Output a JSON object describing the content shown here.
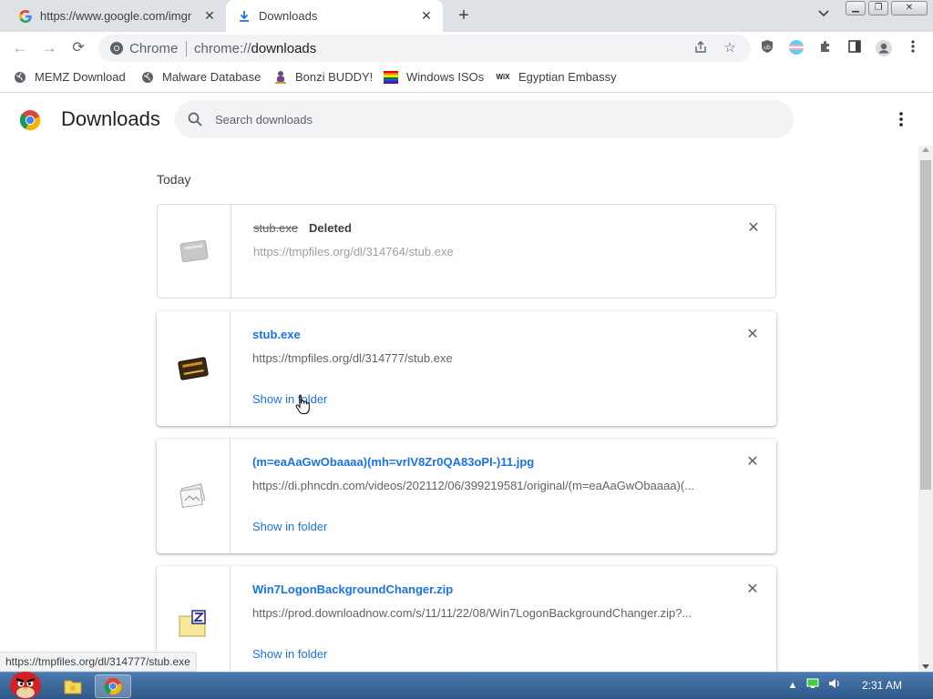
{
  "tabs": [
    {
      "title": "https://www.google.com/imgr",
      "active": false
    },
    {
      "title": "Downloads",
      "active": true
    }
  ],
  "toolbar": {
    "chip": "Chrome",
    "url_scheme": "chrome://",
    "url_host": "downloads"
  },
  "bookmarks": [
    {
      "label": "MEMZ Download",
      "icon": "globe-icon"
    },
    {
      "label": "Malware Database",
      "icon": "globe-icon"
    },
    {
      "label": "Bonzi BUDDY!",
      "icon": "bonzi-icon"
    },
    {
      "label": "Windows ISOs",
      "icon": "rainbow-flag-icon"
    },
    {
      "label": "Egyptian Embassy",
      "icon": "wix-icon"
    }
  ],
  "downloads_page": {
    "title": "Downloads",
    "search_placeholder": "Search downloads",
    "date_header": "Today",
    "items": [
      {
        "filename": "stub.exe",
        "status": "Deleted",
        "url": "https://tmpfiles.org/dl/314764/stub.exe",
        "action": ""
      },
      {
        "filename": "stub.exe",
        "status": "",
        "url": "https://tmpfiles.org/dl/314777/stub.exe",
        "action": "Show in folder"
      },
      {
        "filename": "(m=eaAaGwObaaaa)(mh=vrlV8Zr0QA83oPI-)11.jpg",
        "status": "",
        "url": "https://di.phncdn.com/videos/202112/06/399219581/original/(m=eaAaGwObaaaa)(...",
        "action": "Show in folder"
      },
      {
        "filename": "Win7LogonBackgroundChanger.zip",
        "status": "",
        "url": "https://prod.downloadnow.com/s/11/11/22/08/Win7LogonBackgroundChanger.zip?...",
        "action": "Show in folder"
      }
    ]
  },
  "status_bar": "https://tmpfiles.org/dl/314777/stub.exe",
  "taskbar": {
    "clock": "2:31 AM"
  },
  "colors": {
    "link": "#1a73e8",
    "tabstrip": "#dee1e6",
    "taskbar": "#3a6699"
  }
}
